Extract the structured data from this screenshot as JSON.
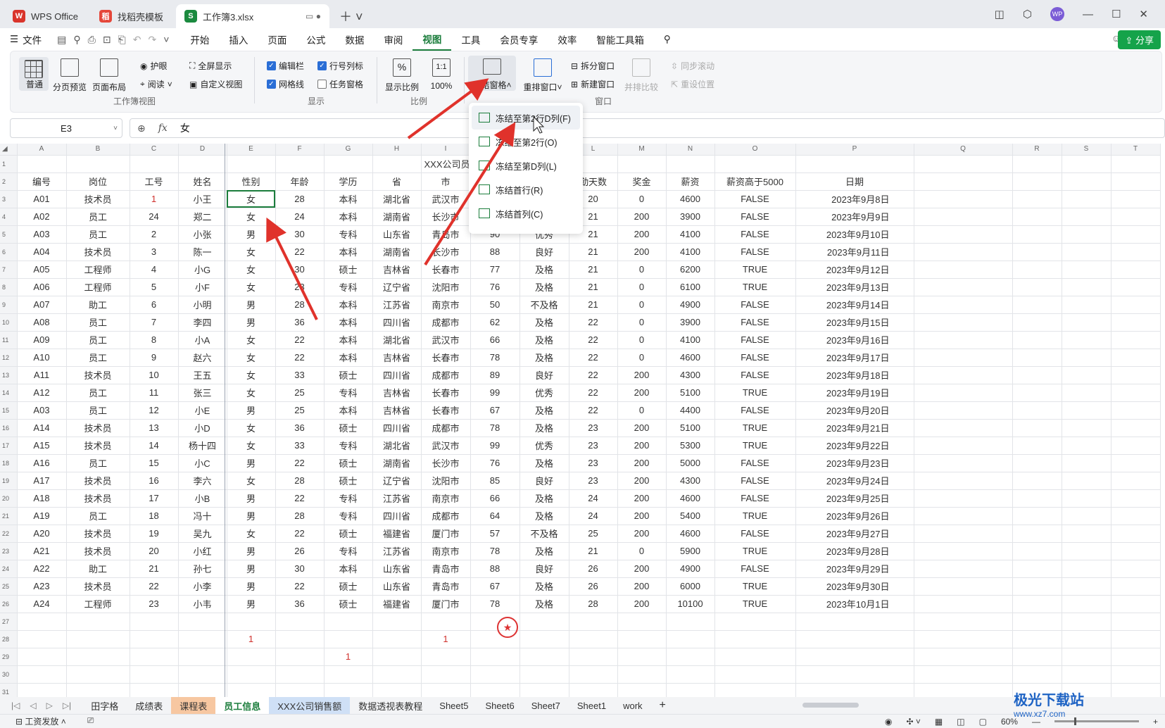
{
  "titlebar": {
    "tabs": [
      {
        "label": "WPS Office",
        "badge": "W",
        "color": "#d9342b"
      },
      {
        "label": "找稻壳模板",
        "badge": "稻",
        "color": "#e5473a"
      },
      {
        "label": "工作簿3.xlsx",
        "badge": "S",
        "color": "#1b8a3f"
      }
    ],
    "avatar": "WP"
  },
  "menubar": {
    "file": "文件",
    "items": [
      "开始",
      "插入",
      "页面",
      "公式",
      "数据",
      "审阅",
      "视图",
      "工具",
      "会员专享",
      "效率",
      "智能工具箱"
    ],
    "active": "视图",
    "share": "分享"
  },
  "ribbon": {
    "normal": "普通",
    "page_break": "分页预览",
    "page_layout": "页面布局",
    "eye_care": "护眼",
    "reading": "阅读",
    "fullscreen": "全屏显示",
    "custom_view": "自定义视图",
    "group_workbook_view": "工作簿视图",
    "formula_bar": "编辑栏",
    "headers": "行号列标",
    "gridlines": "网格线",
    "task_pane": "任务窗格",
    "group_show": "显示",
    "zoom_ratio": "显示比例",
    "zoom_100": "100%",
    "group_ratio": "比例",
    "freeze_panes": "冻结窗格",
    "rearrange": "重排窗口",
    "split": "拆分窗口",
    "new_window": "新建窗口",
    "side_by_side": "并排比较",
    "sync_scroll": "同步滚动",
    "reset_pos": "重设位置",
    "group_window": "窗口"
  },
  "formula_bar": {
    "cell_ref": "E3",
    "fx": "fx",
    "value": "女"
  },
  "freeze_menu": [
    "冻结至第2行D列(F)",
    "冻结至第2行(O)",
    "冻结至第D列(L)",
    "冻结首行(R)",
    "冻结首列(C)"
  ],
  "sheet": {
    "columns": [
      "A",
      "B",
      "C",
      "D",
      "E",
      "F",
      "G",
      "H",
      "I",
      "J",
      "K",
      "L",
      "M",
      "N",
      "O",
      "P",
      "Q",
      "R",
      "S",
      "T"
    ],
    "title_fragment": "XXX公司员",
    "headers": [
      "编号",
      "岗位",
      "工号",
      "姓名",
      "性别",
      "年龄",
      "学历",
      "省",
      "市",
      "",
      "",
      "勤天数",
      "奖金",
      "薪资",
      "薪资高于5000",
      "日期"
    ],
    "rows": [
      [
        "A01",
        "技术员",
        "1",
        "小王",
        "女",
        "28",
        "本科",
        "湖北省",
        "武汉市",
        "",
        "",
        "20",
        "0",
        "4600",
        "FALSE",
        "2023年9月8日"
      ],
      [
        "A02",
        "员工",
        "24",
        "郑二",
        "女",
        "24",
        "本科",
        "湖南省",
        "长沙市",
        "",
        "",
        "21",
        "200",
        "3900",
        "FALSE",
        "2023年9月9日"
      ],
      [
        "A03",
        "员工",
        "2",
        "小张",
        "男",
        "30",
        "专科",
        "山东省",
        "青岛市",
        "90",
        "优秀",
        "21",
        "200",
        "4100",
        "FALSE",
        "2023年9月10日"
      ],
      [
        "A04",
        "技术员",
        "3",
        "陈一",
        "女",
        "22",
        "本科",
        "湖南省",
        "长沙市",
        "88",
        "良好",
        "21",
        "200",
        "4100",
        "FALSE",
        "2023年9月11日"
      ],
      [
        "A05",
        "工程师",
        "4",
        "小G",
        "女",
        "30",
        "硕士",
        "吉林省",
        "长春市",
        "77",
        "及格",
        "21",
        "0",
        "6200",
        "TRUE",
        "2023年9月12日"
      ],
      [
        "A06",
        "工程师",
        "5",
        "小F",
        "女",
        "23",
        "专科",
        "辽宁省",
        "沈阳市",
        "76",
        "及格",
        "21",
        "0",
        "6100",
        "TRUE",
        "2023年9月13日"
      ],
      [
        "A07",
        "助工",
        "6",
        "小明",
        "男",
        "28",
        "本科",
        "江苏省",
        "南京市",
        "50",
        "不及格",
        "21",
        "0",
        "4900",
        "FALSE",
        "2023年9月14日"
      ],
      [
        "A08",
        "员工",
        "7",
        "李四",
        "男",
        "36",
        "本科",
        "四川省",
        "成都市",
        "62",
        "及格",
        "22",
        "0",
        "3900",
        "FALSE",
        "2023年9月15日"
      ],
      [
        "A09",
        "员工",
        "8",
        "小A",
        "女",
        "22",
        "本科",
        "湖北省",
        "武汉市",
        "66",
        "及格",
        "22",
        "0",
        "4100",
        "FALSE",
        "2023年9月16日"
      ],
      [
        "A10",
        "员工",
        "9",
        "赵六",
        "女",
        "22",
        "本科",
        "吉林省",
        "长春市",
        "78",
        "及格",
        "22",
        "0",
        "4600",
        "FALSE",
        "2023年9月17日"
      ],
      [
        "A11",
        "技术员",
        "10",
        "王五",
        "女",
        "33",
        "硕士",
        "四川省",
        "成都市",
        "89",
        "良好",
        "22",
        "200",
        "4300",
        "FALSE",
        "2023年9月18日"
      ],
      [
        "A12",
        "员工",
        "11",
        "张三",
        "女",
        "25",
        "专科",
        "吉林省",
        "长春市",
        "99",
        "优秀",
        "22",
        "200",
        "5100",
        "TRUE",
        "2023年9月19日"
      ],
      [
        "A03",
        "员工",
        "12",
        "小E",
        "男",
        "25",
        "本科",
        "吉林省",
        "长春市",
        "67",
        "及格",
        "22",
        "0",
        "4400",
        "FALSE",
        "2023年9月20日"
      ],
      [
        "A14",
        "技术员",
        "13",
        "小D",
        "女",
        "36",
        "硕士",
        "四川省",
        "成都市",
        "78",
        "及格",
        "23",
        "200",
        "5100",
        "TRUE",
        "2023年9月21日"
      ],
      [
        "A15",
        "技术员",
        "14",
        "杨十四",
        "女",
        "33",
        "专科",
        "湖北省",
        "武汉市",
        "99",
        "优秀",
        "23",
        "200",
        "5300",
        "TRUE",
        "2023年9月22日"
      ],
      [
        "A16",
        "员工",
        "15",
        "小C",
        "男",
        "22",
        "硕士",
        "湖南省",
        "长沙市",
        "76",
        "及格",
        "23",
        "200",
        "5000",
        "FALSE",
        "2023年9月23日"
      ],
      [
        "A17",
        "技术员",
        "16",
        "李六",
        "女",
        "28",
        "硕士",
        "辽宁省",
        "沈阳市",
        "85",
        "良好",
        "23",
        "200",
        "4300",
        "FALSE",
        "2023年9月24日"
      ],
      [
        "A18",
        "技术员",
        "17",
        "小B",
        "男",
        "22",
        "专科",
        "江苏省",
        "南京市",
        "66",
        "及格",
        "24",
        "200",
        "4600",
        "FALSE",
        "2023年9月25日"
      ],
      [
        "A19",
        "员工",
        "18",
        "冯十",
        "男",
        "28",
        "专科",
        "四川省",
        "成都市",
        "64",
        "及格",
        "24",
        "200",
        "5400",
        "TRUE",
        "2023年9月26日"
      ],
      [
        "A20",
        "技术员",
        "19",
        "吴九",
        "女",
        "22",
        "硕士",
        "福建省",
        "厦门市",
        "57",
        "不及格",
        "25",
        "200",
        "4600",
        "FALSE",
        "2023年9月27日"
      ],
      [
        "A21",
        "技术员",
        "20",
        "小红",
        "男",
        "26",
        "专科",
        "江苏省",
        "南京市",
        "78",
        "及格",
        "21",
        "0",
        "5900",
        "TRUE",
        "2023年9月28日"
      ],
      [
        "A22",
        "助工",
        "21",
        "孙七",
        "男",
        "30",
        "本科",
        "山东省",
        "青岛市",
        "88",
        "良好",
        "26",
        "200",
        "4900",
        "FALSE",
        "2023年9月29日"
      ],
      [
        "A23",
        "技术员",
        "22",
        "小李",
        "男",
        "22",
        "硕士",
        "山东省",
        "青岛市",
        "67",
        "及格",
        "26",
        "200",
        "6000",
        "TRUE",
        "2023年9月30日"
      ],
      [
        "A24",
        "工程师",
        "23",
        "小韦",
        "男",
        "36",
        "硕士",
        "福建省",
        "厦门市",
        "78",
        "及格",
        "28",
        "200",
        "10100",
        "TRUE",
        "2023年10月1日"
      ]
    ],
    "extra_marks": {
      "e28": "1",
      "i28": "1",
      "g29": "1"
    }
  },
  "sheet_tabs": [
    "田字格",
    "成绩表",
    "课程表",
    "员工信息",
    "XXX公司销售额",
    "数据透视表教程",
    "Sheet5",
    "Sheet6",
    "Sheet7",
    "Sheet1",
    "work"
  ],
  "active_sheet": "员工信息",
  "status": {
    "left": "工资发放",
    "zoom": "60%"
  },
  "watermark": {
    "name": "极光下载站",
    "url": "www.xz7.com"
  },
  "colors": {
    "accent": "#1b7d3c",
    "arrow": "#e0322b",
    "selected_col": "#e6eefc"
  }
}
